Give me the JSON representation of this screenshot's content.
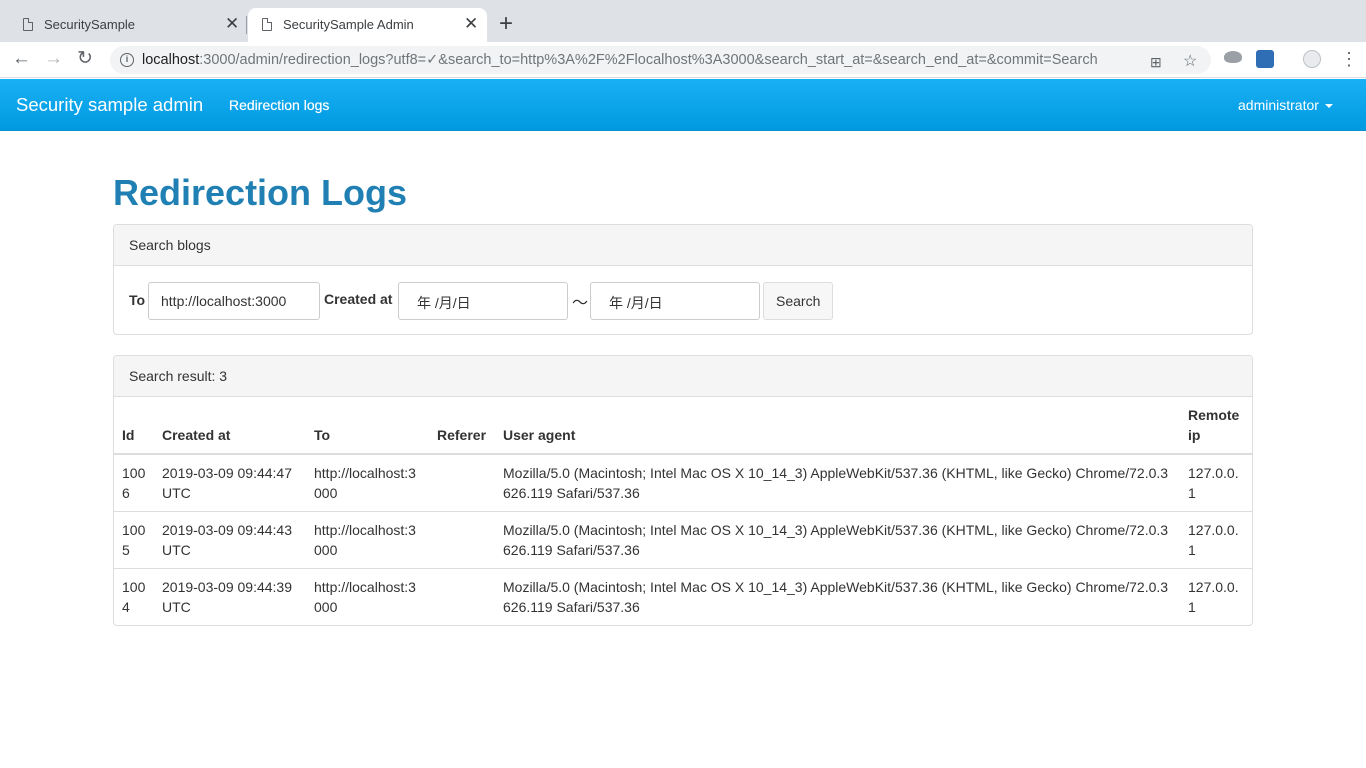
{
  "browser": {
    "tabs": [
      {
        "title": "SecuritySample",
        "active": false
      },
      {
        "title": "SecuritySample Admin",
        "active": true
      }
    ],
    "url_host": "localhost",
    "url_rest": ":3000/admin/redirection_logs?utf8=✓&search_to=http%3A%2F%2Flocalhost%3A3000&search_start_at=&search_end_at=&commit=Search",
    "icons": [
      "back-icon",
      "forward-icon",
      "reload-icon",
      "info-icon",
      "translate-icon",
      "star-icon",
      "extension-icon",
      "profile-icon",
      "menu-icon"
    ]
  },
  "navbar": {
    "brand": "Security sample admin",
    "link": "Redirection logs",
    "user": "administrator",
    "color": "#0ea5ec"
  },
  "page": {
    "title": "Redirection Logs"
  },
  "search": {
    "heading": "Search blogs",
    "to_label": "To",
    "to_value": "http://localhost:3000",
    "created_label": "Created at",
    "start_value": "年 /月/日",
    "tilde": "〜",
    "end_value": "年 /月/日",
    "button": "Search"
  },
  "results": {
    "heading": "Search result: 3",
    "columns": [
      "Id",
      "Created at",
      "To",
      "Referer",
      "User agent",
      "Remote ip"
    ],
    "rows": [
      {
        "id": "1006",
        "created_at": "2019-03-09 09:44:47 UTC",
        "to": "http://localhost:3000",
        "referer": "",
        "user_agent": "Mozilla/5.0 (Macintosh; Intel Mac OS X 10_14_3) AppleWebKit/537.36 (KHTML, like Gecko) Chrome/72.0.3626.119 Safari/537.36",
        "remote_ip": "127.0.0.1"
      },
      {
        "id": "1005",
        "created_at": "2019-03-09 09:44:43 UTC",
        "to": "http://localhost:3000",
        "referer": "",
        "user_agent": "Mozilla/5.0 (Macintosh; Intel Mac OS X 10_14_3) AppleWebKit/537.36 (KHTML, like Gecko) Chrome/72.0.3626.119 Safari/537.36",
        "remote_ip": "127.0.0.1"
      },
      {
        "id": "1004",
        "created_at": "2019-03-09 09:44:39 UTC",
        "to": "http://localhost:3000",
        "referer": "",
        "user_agent": "Mozilla/5.0 (Macintosh; Intel Mac OS X 10_14_3) AppleWebKit/537.36 (KHTML, like Gecko) Chrome/72.0.3626.119 Safari/537.36",
        "remote_ip": "127.0.0.1"
      }
    ]
  }
}
